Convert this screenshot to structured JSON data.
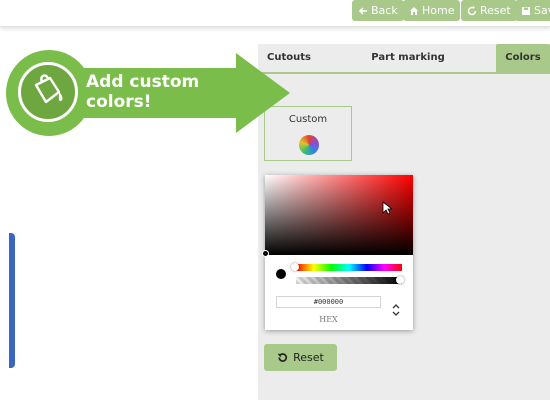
{
  "toolbar": {
    "back_label": "Back",
    "home_label": "Home",
    "reset_label": "Reset",
    "save_label": "Sav"
  },
  "tabs": [
    {
      "label": "Cutouts"
    },
    {
      "label": "Part marking"
    },
    {
      "label": "Colors",
      "active": true
    }
  ],
  "callout": {
    "line1": "Add custom",
    "line2": "colors!",
    "icon": "paint-bucket-icon"
  },
  "custom_color": {
    "label": "Custom"
  },
  "color_picker": {
    "hex_value": "#000000",
    "format_label": "HEX"
  },
  "panel": {
    "reset_label": "Reset"
  },
  "colors": {
    "accent": "#a8c98a",
    "callout_green": "#7bbd4a",
    "panel_bg": "#ececec"
  }
}
